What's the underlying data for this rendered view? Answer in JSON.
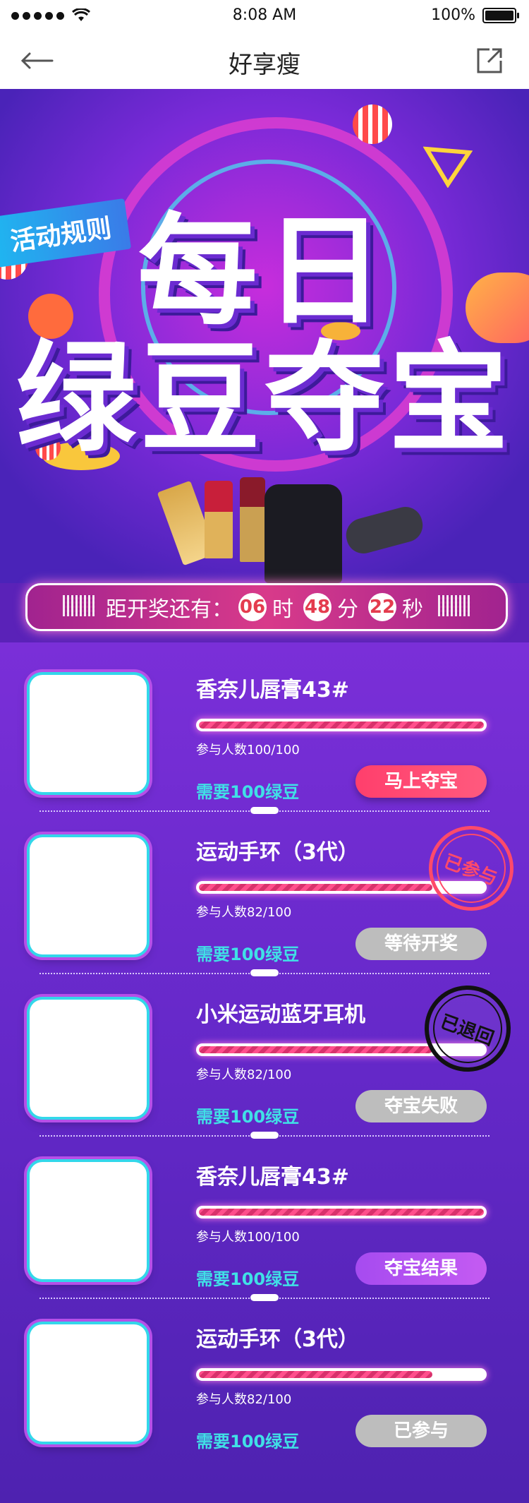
{
  "status": {
    "time": "8:08 AM",
    "battery": "100%"
  },
  "nav": {
    "title": "好享瘦"
  },
  "hero": {
    "rule_tag": "活动规则",
    "title_line1": "每日",
    "title_line2": "绿豆夺宝"
  },
  "countdown": {
    "label": "距开奖还有：",
    "hours": "06",
    "hours_unit": "时",
    "minutes": "48",
    "minutes_unit": "分",
    "seconds": "22",
    "seconds_unit": "秒"
  },
  "items": [
    {
      "name": "香奈儿唇膏43#",
      "participants": "参与人数100/100",
      "progress": 1.0,
      "cost": "需要100绿豆",
      "action": "马上夺宝",
      "action_style": "red"
    },
    {
      "name": "运动手环（3代）",
      "participants": "参与人数82/100",
      "progress": 0.82,
      "cost": "需要100绿豆",
      "action": "等待开奖",
      "action_style": "gray",
      "stamp": "已参与",
      "stamp_style": "red"
    },
    {
      "name": "小米运动蓝牙耳机",
      "participants": "参与人数82/100",
      "progress": 0.82,
      "cost": "需要100绿豆",
      "action": "夺宝失败",
      "action_style": "gray",
      "stamp": "已退回",
      "stamp_style": "black"
    },
    {
      "name": "香奈儿唇膏43#",
      "participants": "参与人数100/100",
      "progress": 1.0,
      "cost": "需要100绿豆",
      "action": "夺宝结果",
      "action_style": "purple"
    },
    {
      "name": "运动手环（3代）",
      "participants": "参与人数82/100",
      "progress": 0.82,
      "cost": "需要100绿豆",
      "action": "已参与",
      "action_style": "gray"
    }
  ],
  "colors": {
    "accent_pink": "#ff3f6c",
    "accent_cyan": "#40e0e6",
    "bg_purple": "#6428c8"
  }
}
